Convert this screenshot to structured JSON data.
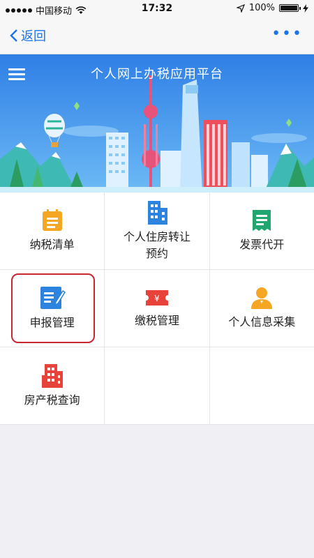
{
  "status_bar": {
    "carrier": "中国移动",
    "time": "17:32",
    "battery": "100%"
  },
  "nav": {
    "back_label": "返回",
    "more_label": "•••"
  },
  "banner": {
    "title": "个人网上办税应用平台"
  },
  "menu": [
    {
      "label": "纳税清单",
      "icon": "document-list-icon",
      "color": "#f5a623"
    },
    {
      "label": "个人住房转让\n预约",
      "icon": "building-icon",
      "color": "#2d83e0"
    },
    {
      "label": "发票代开",
      "icon": "receipt-icon",
      "color": "#21a571"
    },
    {
      "label": "申报管理",
      "icon": "edit-document-icon",
      "color": "#2d83e0"
    },
    {
      "label": "缴税管理",
      "icon": "tax-payment-icon",
      "color": "#e8433b"
    },
    {
      "label": "个人信息采集",
      "icon": "person-icon",
      "color": "#f5a623"
    },
    {
      "label": "房产税查询",
      "icon": "house-building-icon",
      "color": "#e8433b"
    }
  ]
}
